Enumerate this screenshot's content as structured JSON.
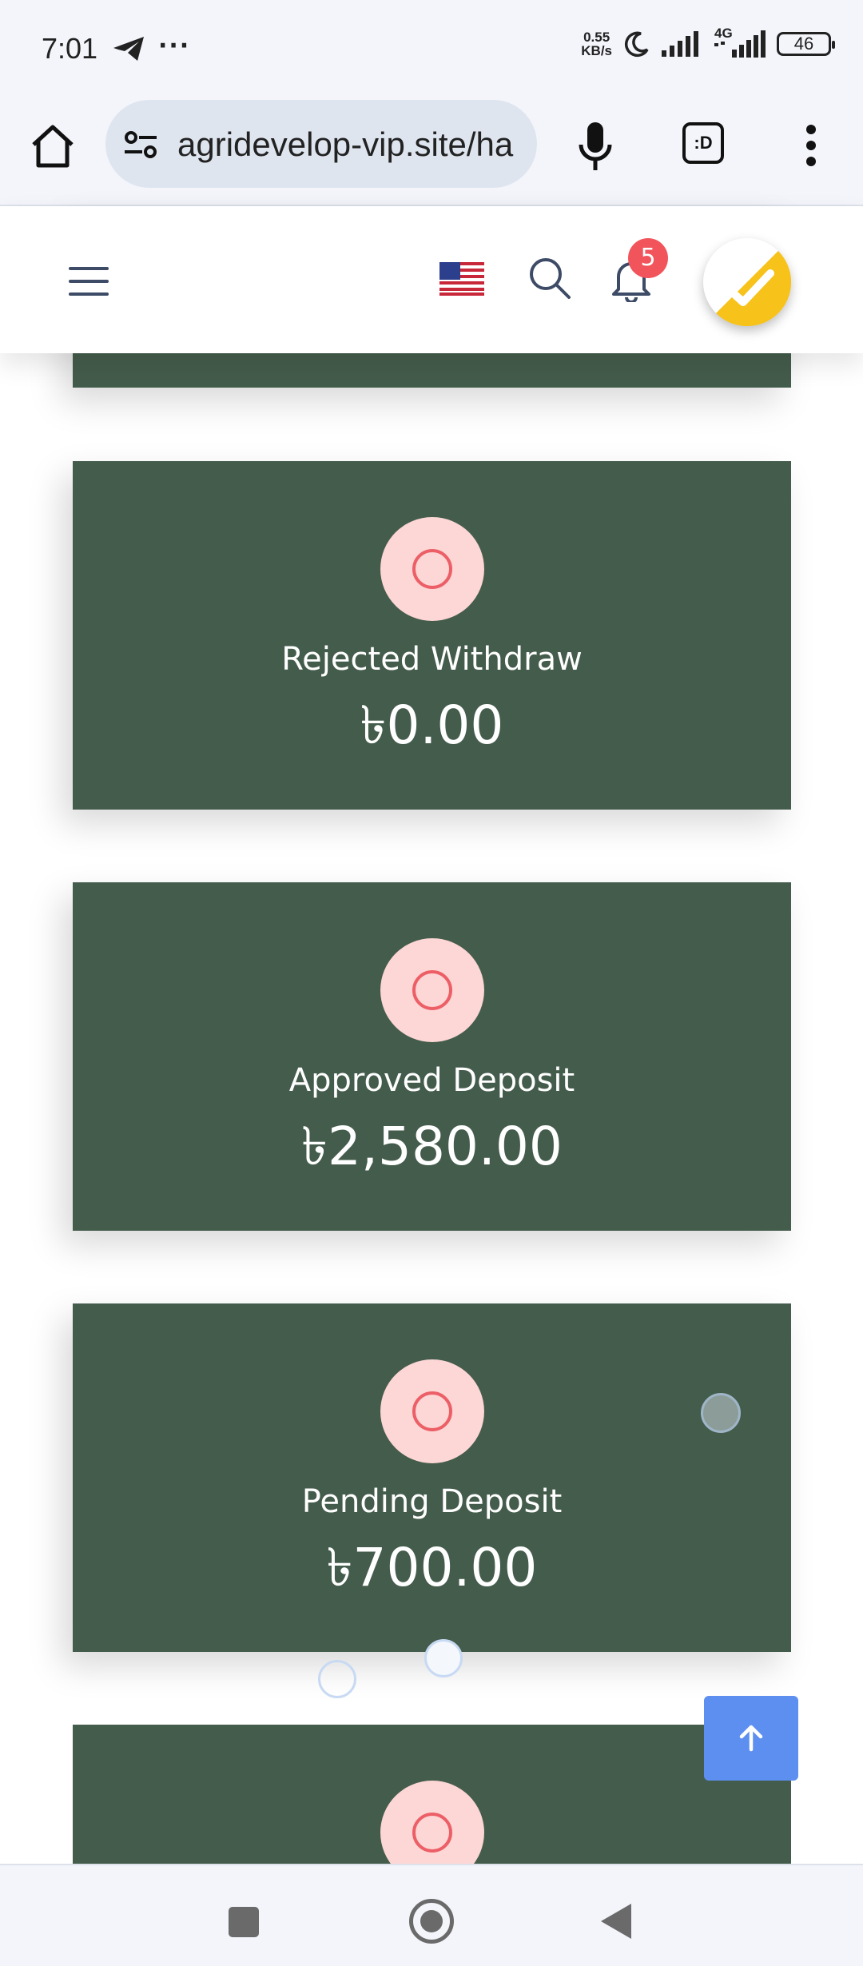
{
  "status_bar": {
    "time": "7:01",
    "extra": "···",
    "net_speed_value": "0.55",
    "net_speed_unit": "KB/s",
    "network": "4G",
    "battery": "46"
  },
  "browser": {
    "url": "agridevelop-vip.site/ha",
    "tab_label": ":D"
  },
  "header": {
    "notification_count": "5"
  },
  "cards": [
    {
      "label": "",
      "amount": ""
    },
    {
      "label": "Rejected Withdraw",
      "amount": "৳0.00"
    },
    {
      "label": "Approved Deposit",
      "amount": "৳2,580.00"
    },
    {
      "label": "Pending Deposit",
      "amount": "৳700.00"
    },
    {
      "label": "",
      "amount": ""
    }
  ],
  "colors": {
    "card_bg": "#445c4b",
    "icon_circle": "#fdd6d6",
    "icon_ring": "#ec5f66",
    "scroll_top": "#5c8ff0",
    "badge": "#f2545b",
    "avatar_yellow": "#f7c21a"
  }
}
